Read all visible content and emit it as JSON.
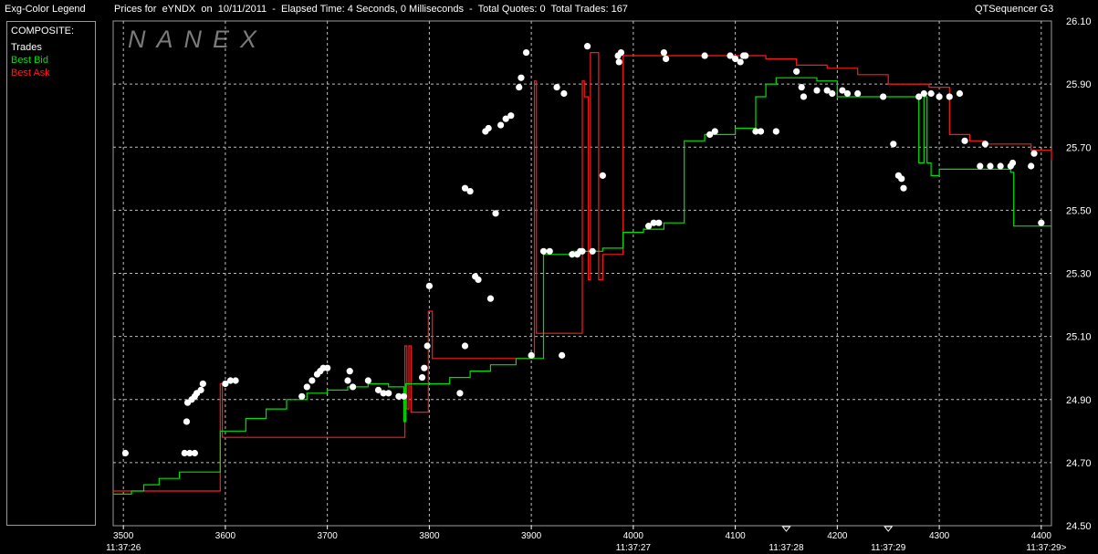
{
  "header": {
    "legend_title": "Exg-Color Legend",
    "prices_title": "Prices for  eYNDX  on  10/11/2011  -  Elapsed Time: 4 Seconds, 0 Milliseconds  -  Total Quotes: 0  Total Trades: 167",
    "app_name": "QTSequencer G3"
  },
  "legend": {
    "heading": "COMPOSITE:",
    "items": [
      {
        "label": "Trades",
        "color": "#ffffff"
      },
      {
        "label": "Best Bid",
        "color": "#00e000"
      },
      {
        "label": "Best Ask",
        "color": "#ff1a1a"
      }
    ]
  },
  "watermark": "NANEX",
  "chart_data": {
    "type": "line",
    "xlim": [
      3490,
      4410
    ],
    "ylim": [
      24.5,
      26.1
    ],
    "grid": true,
    "x_ticks": [
      3500,
      3600,
      3700,
      3800,
      3900,
      4000,
      4100,
      4200,
      4300,
      4400
    ],
    "y_ticks": [
      "26.10",
      "25.90",
      "25.70",
      "25.50",
      "25.30",
      "25.10",
      "24.90",
      "24.70",
      "24.50"
    ],
    "time_ticks": [
      {
        "x": 3500,
        "label": "11:37:26"
      },
      {
        "x": 4000,
        "label": "11:37:27"
      },
      {
        "x": 4150,
        "label": "11:37:28"
      },
      {
        "x": 4250,
        "label": "11:37:29"
      },
      {
        "x": 4405,
        "label": "11:37:29>"
      }
    ],
    "time_markers": [
      4150,
      4250
    ],
    "series": [
      {
        "name": "Best Ask",
        "color": "#ff1a1a",
        "x": [
          3490,
          3595,
          3595,
          3597,
          3597,
          3776,
          3776,
          3778,
          3778,
          3780,
          3780,
          3782,
          3782,
          3799,
          3799,
          3803,
          3803,
          3903,
          3903,
          3905,
          3905,
          3950,
          3950,
          3952,
          3952,
          3956,
          3956,
          3958,
          3958,
          3966,
          3966,
          3970,
          3970,
          3990,
          3990,
          4095,
          4130,
          4160,
          4190,
          4220,
          4250,
          4290,
          4300,
          4310,
          4330,
          4345,
          4360,
          4390,
          4410
        ],
        "y": [
          24.61,
          24.61,
          24.95,
          24.95,
          24.78,
          24.78,
          25.07,
          25.07,
          24.87,
          24.87,
          25.07,
          25.07,
          24.86,
          24.86,
          25.18,
          25.18,
          25.03,
          25.03,
          25.91,
          25.91,
          25.11,
          25.11,
          25.91,
          25.91,
          25.86,
          25.86,
          25.28,
          25.28,
          26.0,
          26.0,
          25.28,
          25.28,
          25.36,
          25.36,
          25.99,
          25.99,
          25.98,
          25.96,
          25.95,
          25.93,
          25.9,
          25.89,
          25.89,
          25.74,
          25.72,
          25.71,
          25.71,
          25.69,
          25.66
        ]
      },
      {
        "name": "Best Bid",
        "color": "#00e000",
        "x": [
          3490,
          3508,
          3520,
          3535,
          3555,
          3575,
          3595,
          3597,
          3620,
          3640,
          3660,
          3680,
          3700,
          3720,
          3740,
          3760,
          3775,
          3777,
          3800,
          3820,
          3840,
          3860,
          3885,
          3910,
          3912,
          3930,
          3940,
          3955,
          3970,
          3990,
          4010,
          4030,
          4050,
          4070,
          4100,
          4120,
          4130,
          4140,
          4160,
          4180,
          4200,
          4250,
          4270,
          4280,
          4285,
          4288,
          4292,
          4300,
          4330,
          4350,
          4370,
          4373,
          4378,
          4410
        ],
        "y": [
          24.6,
          24.61,
          24.63,
          24.65,
          24.67,
          24.67,
          24.8,
          24.8,
          24.84,
          24.87,
          24.9,
          24.92,
          24.93,
          24.94,
          24.95,
          24.94,
          24.83,
          24.95,
          24.95,
          24.97,
          24.99,
          25.01,
          25.03,
          25.03,
          25.36,
          25.36,
          25.37,
          25.37,
          25.38,
          25.43,
          25.44,
          25.46,
          25.72,
          25.74,
          25.76,
          25.86,
          25.9,
          25.92,
          25.92,
          25.91,
          25.86,
          25.86,
          25.86,
          25.65,
          25.86,
          25.65,
          25.61,
          25.63,
          25.63,
          25.63,
          25.62,
          25.45,
          25.45,
          25.45
        ]
      }
    ],
    "trades": [
      [
        3502,
        24.73
      ],
      [
        3560,
        24.73
      ],
      [
        3565,
        24.73
      ],
      [
        3570,
        24.73
      ],
      [
        3562,
        24.83
      ],
      [
        3563,
        24.89
      ],
      [
        3567,
        24.9
      ],
      [
        3570,
        24.91
      ],
      [
        3572,
        24.92
      ],
      [
        3576,
        24.93
      ],
      [
        3578,
        24.95
      ],
      [
        3600,
        24.95
      ],
      [
        3605,
        24.96
      ],
      [
        3610,
        24.96
      ],
      [
        3675,
        24.91
      ],
      [
        3680,
        24.94
      ],
      [
        3685,
        24.96
      ],
      [
        3690,
        24.98
      ],
      [
        3693,
        24.99
      ],
      [
        3696,
        25.0
      ],
      [
        3700,
        25.0
      ],
      [
        3720,
        24.96
      ],
      [
        3722,
        24.99
      ],
      [
        3725,
        24.94
      ],
      [
        3740,
        24.96
      ],
      [
        3750,
        24.93
      ],
      [
        3755,
        24.92
      ],
      [
        3760,
        24.92
      ],
      [
        3770,
        24.91
      ],
      [
        3775,
        24.91
      ],
      [
        3793,
        24.97
      ],
      [
        3795,
        25.0
      ],
      [
        3798,
        25.07
      ],
      [
        3800,
        25.26
      ],
      [
        3830,
        24.92
      ],
      [
        3835,
        25.07
      ],
      [
        3835,
        25.57
      ],
      [
        3840,
        25.56
      ],
      [
        3845,
        25.29
      ],
      [
        3848,
        25.28
      ],
      [
        3855,
        25.75
      ],
      [
        3858,
        25.76
      ],
      [
        3860,
        25.22
      ],
      [
        3865,
        25.49
      ],
      [
        3870,
        25.77
      ],
      [
        3875,
        25.79
      ],
      [
        3880,
        25.8
      ],
      [
        3888,
        25.89
      ],
      [
        3890,
        25.92
      ],
      [
        3895,
        26.0
      ],
      [
        3900,
        25.04
      ],
      [
        3912,
        25.37
      ],
      [
        3918,
        25.37
      ],
      [
        3925,
        25.89
      ],
      [
        3930,
        25.04
      ],
      [
        3932,
        25.87
      ],
      [
        3940,
        25.36
      ],
      [
        3945,
        25.36
      ],
      [
        3948,
        25.37
      ],
      [
        3950,
        25.37
      ],
      [
        3955,
        26.02
      ],
      [
        3960,
        25.37
      ],
      [
        3970,
        25.61
      ],
      [
        3985,
        25.99
      ],
      [
        3986,
        25.97
      ],
      [
        3988,
        26.0
      ],
      [
        4015,
        25.45
      ],
      [
        4020,
        25.46
      ],
      [
        4025,
        25.46
      ],
      [
        4030,
        26.0
      ],
      [
        4032,
        25.98
      ],
      [
        4070,
        25.99
      ],
      [
        4075,
        25.74
      ],
      [
        4080,
        25.75
      ],
      [
        4095,
        25.99
      ],
      [
        4100,
        25.98
      ],
      [
        4105,
        25.97
      ],
      [
        4108,
        25.99
      ],
      [
        4110,
        25.99
      ],
      [
        4120,
        25.75
      ],
      [
        4125,
        25.75
      ],
      [
        4140,
        25.75
      ],
      [
        4160,
        25.94
      ],
      [
        4165,
        25.89
      ],
      [
        4167,
        25.86
      ],
      [
        4180,
        25.88
      ],
      [
        4190,
        25.88
      ],
      [
        4195,
        25.87
      ],
      [
        4205,
        25.88
      ],
      [
        4210,
        25.87
      ],
      [
        4220,
        25.87
      ],
      [
        4245,
        25.86
      ],
      [
        4255,
        25.71
      ],
      [
        4260,
        25.61
      ],
      [
        4263,
        25.6
      ],
      [
        4265,
        25.57
      ],
      [
        4280,
        25.86
      ],
      [
        4285,
        25.87
      ],
      [
        4292,
        25.87
      ],
      [
        4300,
        25.86
      ],
      [
        4310,
        25.86
      ],
      [
        4320,
        25.87
      ],
      [
        4325,
        25.72
      ],
      [
        4340,
        25.64
      ],
      [
        4345,
        25.71
      ],
      [
        4350,
        25.64
      ],
      [
        4360,
        25.64
      ],
      [
        4370,
        25.64
      ],
      [
        4372,
        25.65
      ],
      [
        4390,
        25.64
      ],
      [
        4393,
        25.68
      ],
      [
        4400,
        25.46
      ]
    ]
  }
}
